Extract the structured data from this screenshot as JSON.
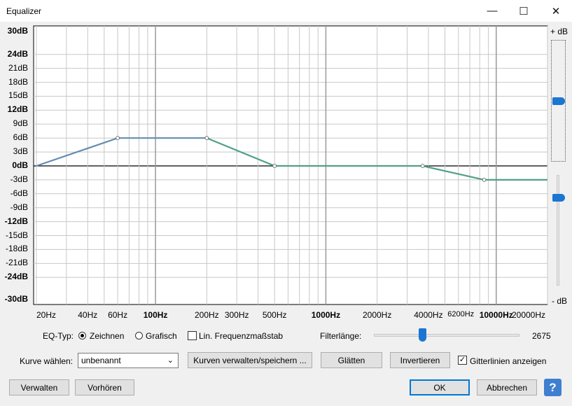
{
  "window": {
    "title": "Equalizer",
    "min_glyph": "—",
    "max_glyph": "☐",
    "close_glyph": "✕"
  },
  "plot": {
    "y_labels": [
      {
        "text": "30dB",
        "bold": true,
        "db": 30,
        "extra": true
      },
      {
        "text": "24dB",
        "bold": true,
        "db": 24
      },
      {
        "text": "21dB",
        "db": 21
      },
      {
        "text": "18dB",
        "db": 18
      },
      {
        "text": "15dB",
        "db": 15
      },
      {
        "text": "12dB",
        "bold": true,
        "db": 12
      },
      {
        "text": "9dB",
        "db": 9
      },
      {
        "text": "6dB",
        "db": 6
      },
      {
        "text": "3dB",
        "db": 3
      },
      {
        "text": "0dB",
        "bold": true,
        "db": 0
      },
      {
        "text": "-3dB",
        "db": -3
      },
      {
        "text": "-6dB",
        "db": -6
      },
      {
        "text": "-9dB",
        "db": -9
      },
      {
        "text": "-12dB",
        "bold": true,
        "db": -12
      },
      {
        "text": "-15dB",
        "db": -15
      },
      {
        "text": "-18dB",
        "db": -18
      },
      {
        "text": "-21dB",
        "db": -21
      },
      {
        "text": "-24dB",
        "bold": true,
        "db": -24
      },
      {
        "text": "-30dB",
        "bold": true,
        "db": -30,
        "extra": true
      }
    ],
    "x_labels": [
      {
        "text": "20Hz",
        "hz": 20
      },
      {
        "text": "40Hz",
        "hz": 40
      },
      {
        "text": "60Hz",
        "hz": 60
      },
      {
        "text": "100Hz",
        "hz": 100,
        "bold": true
      },
      {
        "text": "200Hz",
        "hz": 200
      },
      {
        "text": "300Hz",
        "hz": 300
      },
      {
        "text": "500Hz",
        "hz": 500
      },
      {
        "text": "1000Hz",
        "hz": 1000,
        "bold": true
      },
      {
        "text": "2000Hz",
        "hz": 2000
      },
      {
        "text": "4000Hz",
        "hz": 4000
      },
      {
        "text": "6200Hz",
        "hz": 6200,
        "small": true
      },
      {
        "text": "10000Hz",
        "hz": 10000,
        "bold": true
      },
      {
        "text": "20000Hz",
        "hz": 20000
      }
    ],
    "slider_top_label": "+ dB",
    "slider_bottom_label": "- dB",
    "curve_points": [
      {
        "hz": 20,
        "db": 0
      },
      {
        "hz": 60,
        "db": 6
      },
      {
        "hz": 200,
        "db": 6
      },
      {
        "hz": 500,
        "db": 0
      },
      {
        "hz": 3700,
        "db": 0
      },
      {
        "hz": 8500,
        "db": -3
      },
      {
        "hz": 20000,
        "db": -3
      }
    ],
    "curve_color": "#4fa08b",
    "curve_color2": "#7080d0"
  },
  "controls": {
    "eq_type_label": "EQ-Typ:",
    "draw_label": "Zeichnen",
    "graphic_label": "Grafisch",
    "lin_freq_label": "Lin. Frequenzmaßstab",
    "filter_length_label": "Filterlänge:",
    "filter_length_value": "2675",
    "filter_length_fraction": 0.33,
    "curve_select_label": "Kurve wählen:",
    "curve_select_value": "unbenannt",
    "manage_curves_button": "Kurven verwalten/speichern ...",
    "smooth_button": "Glätten",
    "invert_button": "Invertieren",
    "gridlines_label": "Gitterlinien anzeigen",
    "gridlines_checked": true,
    "manage_button": "Verwalten",
    "preview_button": "Vorhören",
    "ok_button": "OK",
    "cancel_button": "Abbrechen",
    "help_glyph": "?"
  }
}
